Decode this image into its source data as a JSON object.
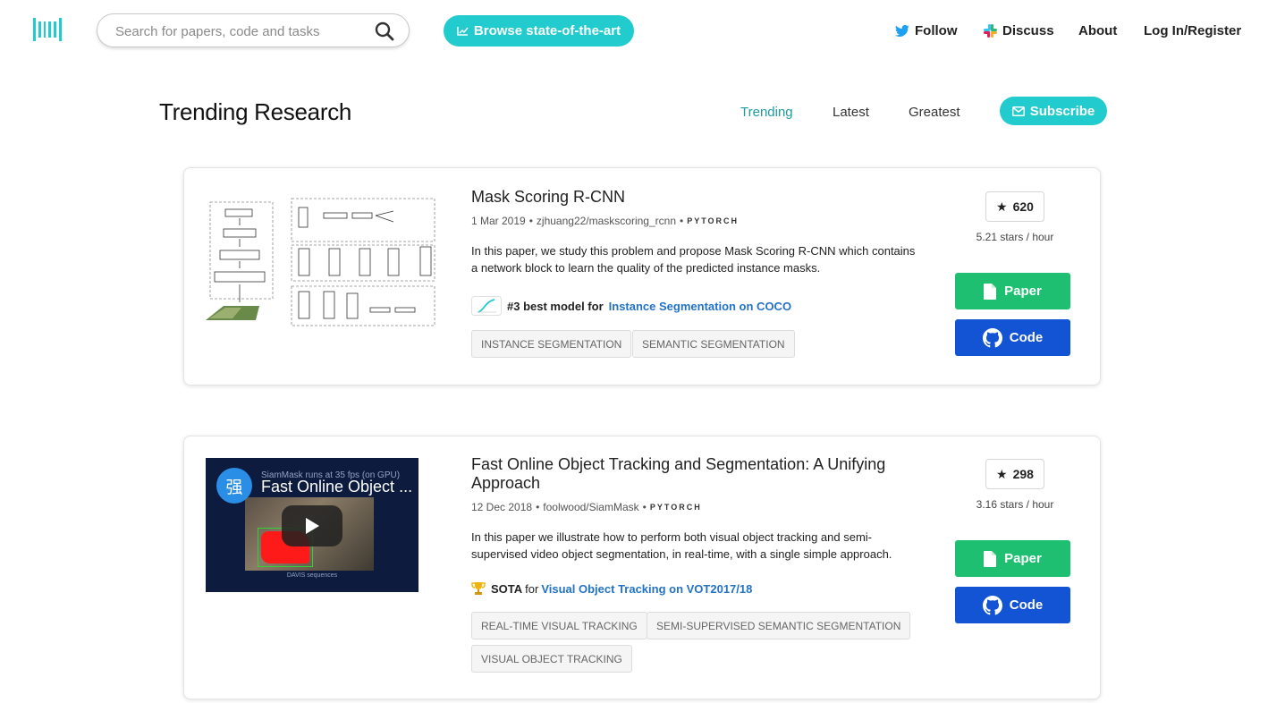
{
  "nav": {
    "search_placeholder": "Search for papers, code and tasks",
    "browse_label": "Browse state-of-the-art",
    "follow_label": "Follow",
    "discuss_label": "Discuss",
    "about_label": "About",
    "login_label": "Log In/Register"
  },
  "header": {
    "title": "Trending Research",
    "filters": [
      "Trending",
      "Latest",
      "Greatest"
    ],
    "subscribe_label": "Subscribe"
  },
  "papers": [
    {
      "title": "Mask Scoring R-CNN",
      "date": "1 Mar 2019",
      "repo": "zjhuang22/maskscoring_rcnn",
      "framework": "PYTORCH",
      "abstract": "In this paper, we study this problem and propose Mask Scoring R-CNN which contains a network block to learn the quality of the predicted instance masks.",
      "sota_prefix": "#3 best model for",
      "sota_task": "Instance Segmentation on COCO",
      "tags": [
        "INSTANCE SEGMENTATION",
        "SEMANTIC SEGMENTATION"
      ],
      "stars": "620",
      "stars_rate": "5.21 stars / hour",
      "paper_label": "Paper",
      "code_label": "Code"
    },
    {
      "title": "Fast Online Object Tracking and Segmentation: A Unifying Approach",
      "date": "12 Dec 2018",
      "repo": "foolwood/SiamMask",
      "framework": "PYTORCH",
      "abstract": "In this paper we illustrate how to perform both visual object tracking and semi-supervised video object segmentation, in real-time, with a single simple approach.",
      "sota_prefix": "SOTA",
      "sota_for": "for",
      "sota_task": "Visual Object Tracking on VOT2017/18",
      "tags": [
        "REAL-TIME VISUAL TRACKING",
        "SEMI-SUPERVISED SEMANTIC SEGMENTATION",
        "VISUAL OBJECT TRACKING"
      ],
      "stars": "298",
      "stars_rate": "3.16 stars / hour",
      "paper_label": "Paper",
      "code_label": "Code",
      "video": {
        "channel_avatar": "强",
        "title": "Fast Online Object ...",
        "overlay_text": "SiamMask runs at 35 fps (on GPU)",
        "caption": "DAVIS sequences"
      }
    }
  ],
  "colors": {
    "accent": "#21cbce",
    "paper_button": "#1fbf72",
    "code_button": "#1254d4",
    "link": "#2372c6"
  },
  "icons": [
    "papers-with-code-logo",
    "search-icon",
    "chart-icon",
    "twitter-icon",
    "slack-icon",
    "envelope-icon",
    "star-icon",
    "file-icon",
    "github-icon",
    "trophy-icon",
    "play-icon"
  ]
}
